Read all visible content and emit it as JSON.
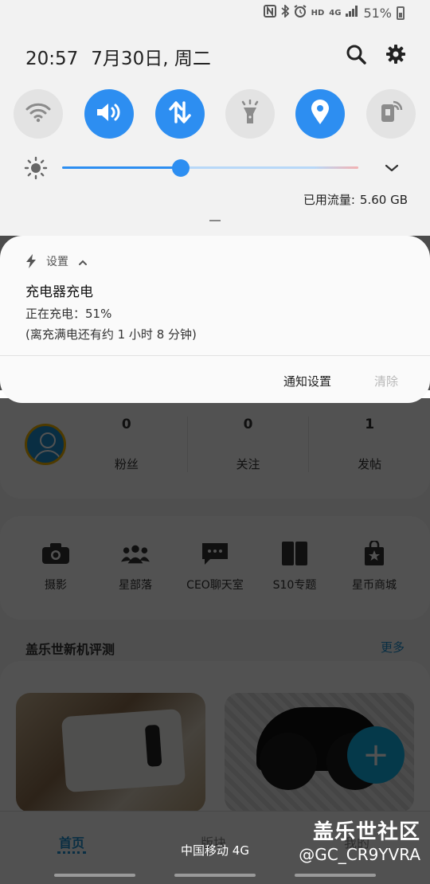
{
  "status_bar": {
    "network": "4G",
    "hd": "HD",
    "battery_percent": "51%"
  },
  "quick_panel": {
    "time": "20:57",
    "date": "7月30日, 周二",
    "tiles": [
      {
        "icon": "wifi-icon",
        "active": false
      },
      {
        "icon": "sound-icon",
        "active": true
      },
      {
        "icon": "mobile-data-icon",
        "active": true
      },
      {
        "icon": "flashlight-icon",
        "active": false
      },
      {
        "icon": "location-icon",
        "active": true
      },
      {
        "icon": "nfc-icon",
        "active": false
      }
    ],
    "brightness_level": 0.4,
    "data_usage_label": "已用流量:",
    "data_usage_value": "5.60 GB",
    "accent_color": "#2d8ef1"
  },
  "notification": {
    "app_name": "设置",
    "title": "充电器充电",
    "line1": "正在充电：51%",
    "line2": "(离充满电还有约 1 小时 8 分钟)",
    "settings_label": "通知设置",
    "clear_label": "清除"
  },
  "background_app": {
    "stats": [
      {
        "value": "0",
        "label": "粉丝"
      },
      {
        "value": "0",
        "label": "关注"
      },
      {
        "value": "1",
        "label": "发帖"
      }
    ],
    "shortcuts": [
      {
        "icon": "camera-icon",
        "label": "摄影"
      },
      {
        "icon": "group-icon",
        "label": "星部落"
      },
      {
        "icon": "chat-icon",
        "label": "CEO聊天室"
      },
      {
        "icon": "phone-icon",
        "label": "S10专题"
      },
      {
        "icon": "shopping-bag-icon",
        "label": "星币商城"
      }
    ],
    "section_title": "盖乐世新机评测",
    "section_more": "更多",
    "fab_label": "+",
    "nav": {
      "home": "首页",
      "board": "版块",
      "mine": "我的"
    }
  },
  "carrier": "中国移动 4G",
  "watermark": {
    "main": "盖乐世社区",
    "sub": "@GC_CR9YVRA"
  }
}
